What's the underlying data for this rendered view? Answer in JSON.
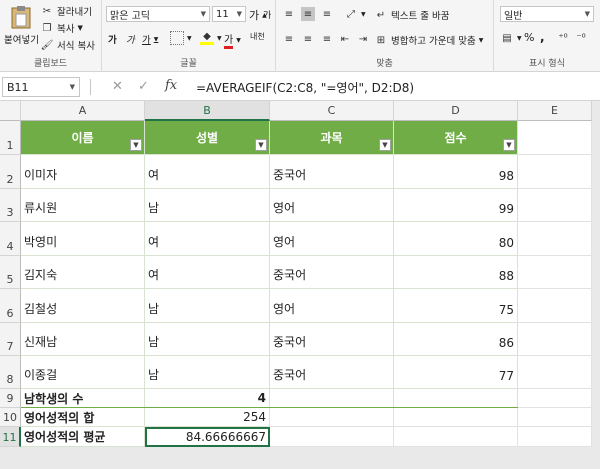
{
  "ribbon": {
    "clipboard": {
      "paste": "붙여넣기",
      "cut": "잘라내기",
      "copy": "복사",
      "format_painter": "서식 복사",
      "label": "클립보드"
    },
    "font": {
      "font_name": "맑은 고딕",
      "font_size": "11",
      "grow": "가",
      "shrink": "가",
      "bold": "가",
      "italic": "가",
      "underline": "가",
      "font_color_glyph": "가",
      "phonetic": "내천",
      "label": "글꼴"
    },
    "alignment": {
      "wrap_text": "텍스트 줄 바꿈",
      "merge_center": "병합하고 가운데 맞춤",
      "label": "맞춤"
    },
    "number": {
      "format": "일반",
      "percent": "%",
      "comma": ",",
      "label": "표시 형식"
    }
  },
  "formula_bar": {
    "name_box": "B11",
    "cancel": "✕",
    "enter": "✓",
    "fx": "fx",
    "formula": "=AVERAGEIF(C2:C8, \"=영어\", D2:D8)"
  },
  "columns": [
    "A",
    "B",
    "C",
    "D",
    "E"
  ],
  "rows": [
    "1",
    "2",
    "3",
    "4",
    "5",
    "6",
    "7",
    "8",
    "9",
    "10",
    "11"
  ],
  "table": {
    "headers": [
      "이름",
      "성별",
      "과목",
      "점수"
    ],
    "records": [
      {
        "name": "이미자",
        "gender": "여",
        "subject": "중국어",
        "score": "98"
      },
      {
        "name": "류시원",
        "gender": "남",
        "subject": "영어",
        "score": "99"
      },
      {
        "name": "박영미",
        "gender": "여",
        "subject": "영어",
        "score": "80"
      },
      {
        "name": "김지숙",
        "gender": "여",
        "subject": "중국어",
        "score": "88"
      },
      {
        "name": "김철성",
        "gender": "남",
        "subject": "영어",
        "score": "75"
      },
      {
        "name": "신재남",
        "gender": "남",
        "subject": "중국어",
        "score": "86"
      },
      {
        "name": "이종걸",
        "gender": "남",
        "subject": "중국어",
        "score": "77"
      }
    ]
  },
  "summary": [
    {
      "label": "남학생의 수",
      "value": "4"
    },
    {
      "label": "영어성적의 합",
      "value": "254"
    },
    {
      "label": "영어성적의 평균",
      "value": "84.66666667"
    }
  ],
  "colors": {
    "accent": "#217346",
    "table_header": "#70ad47",
    "font_red": "#e02020",
    "highlight_yellow": "#ffff00"
  }
}
